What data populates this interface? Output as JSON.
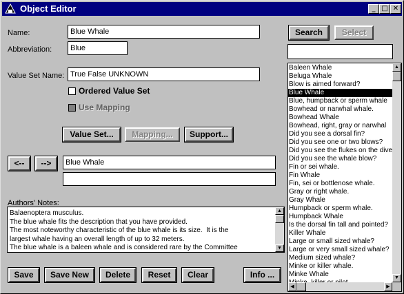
{
  "window": {
    "title": "Object Editor",
    "minimize": "_",
    "maximize": "□",
    "close": "✕"
  },
  "form": {
    "name_label": "Name:",
    "name_value": "Blue Whale",
    "abbrev_label": "Abbreviation:",
    "abbrev_value": "Blue",
    "valueset_label": "Value Set Name:",
    "valueset_value": "True False UNKNOWN",
    "ordered_label": "Ordered Value Set",
    "ordered_checked": false,
    "mapping_label": "Use Mapping",
    "mapping_checked": false
  },
  "mid_buttons": {
    "value_set": "Value Set...",
    "mapping": "Mapping...",
    "support": "Support..."
  },
  "nav": {
    "prev": "<--",
    "next": "-->",
    "current_value": "Blue Whale",
    "second_value": ""
  },
  "notes": {
    "label": "Authors' Notes:",
    "lines": [
      "Balaenoptera musculus.",
      "The blue whale fits the description that you have provided.",
      "The most noteworthy characteristic of the blue whale is its size.  It is the",
      "largest whale having an overall length of up to 32 meters.",
      "The blue whale is a baleen whale and is considered rare by the Committee"
    ]
  },
  "bottom_buttons": {
    "save": "Save",
    "save_new": "Save New",
    "delete": "Delete",
    "reset": "Reset",
    "clear": "Clear",
    "info": "Info ..."
  },
  "side": {
    "search": "Search",
    "select": "Select",
    "search_input": ""
  },
  "object_list": {
    "selected_index": 3,
    "items": [
      "Baleen Whale",
      "Beluga Whale",
      "Blow is aimed forward?",
      "Blue Whale",
      "Blue, humpback or sperm whale",
      "Bowhead or narwhal whale.",
      "Bowhead Whale",
      "Bowhead, right, gray or narwhal",
      "Did you see a dorsal fin?",
      "Did you see one or two blows?",
      "Did you see the flukes on the dive?",
      "Did you see the whale blow?",
      "Fin or sei whale.",
      "Fin Whale",
      "Fin, sei or bottlenose whale.",
      "Gray or right whale.",
      "Gray Whale",
      "Humpback or sperm whale.",
      "Humpback Whale",
      "Is the dorsal fin tall and pointed?",
      "Killer Whale",
      "Large or small sized whale?",
      "Large or very small sized whale?",
      "Medium sized whale?",
      "Minke or killer whale.",
      "Minke Whale",
      "Minke, killer or pilot"
    ]
  }
}
